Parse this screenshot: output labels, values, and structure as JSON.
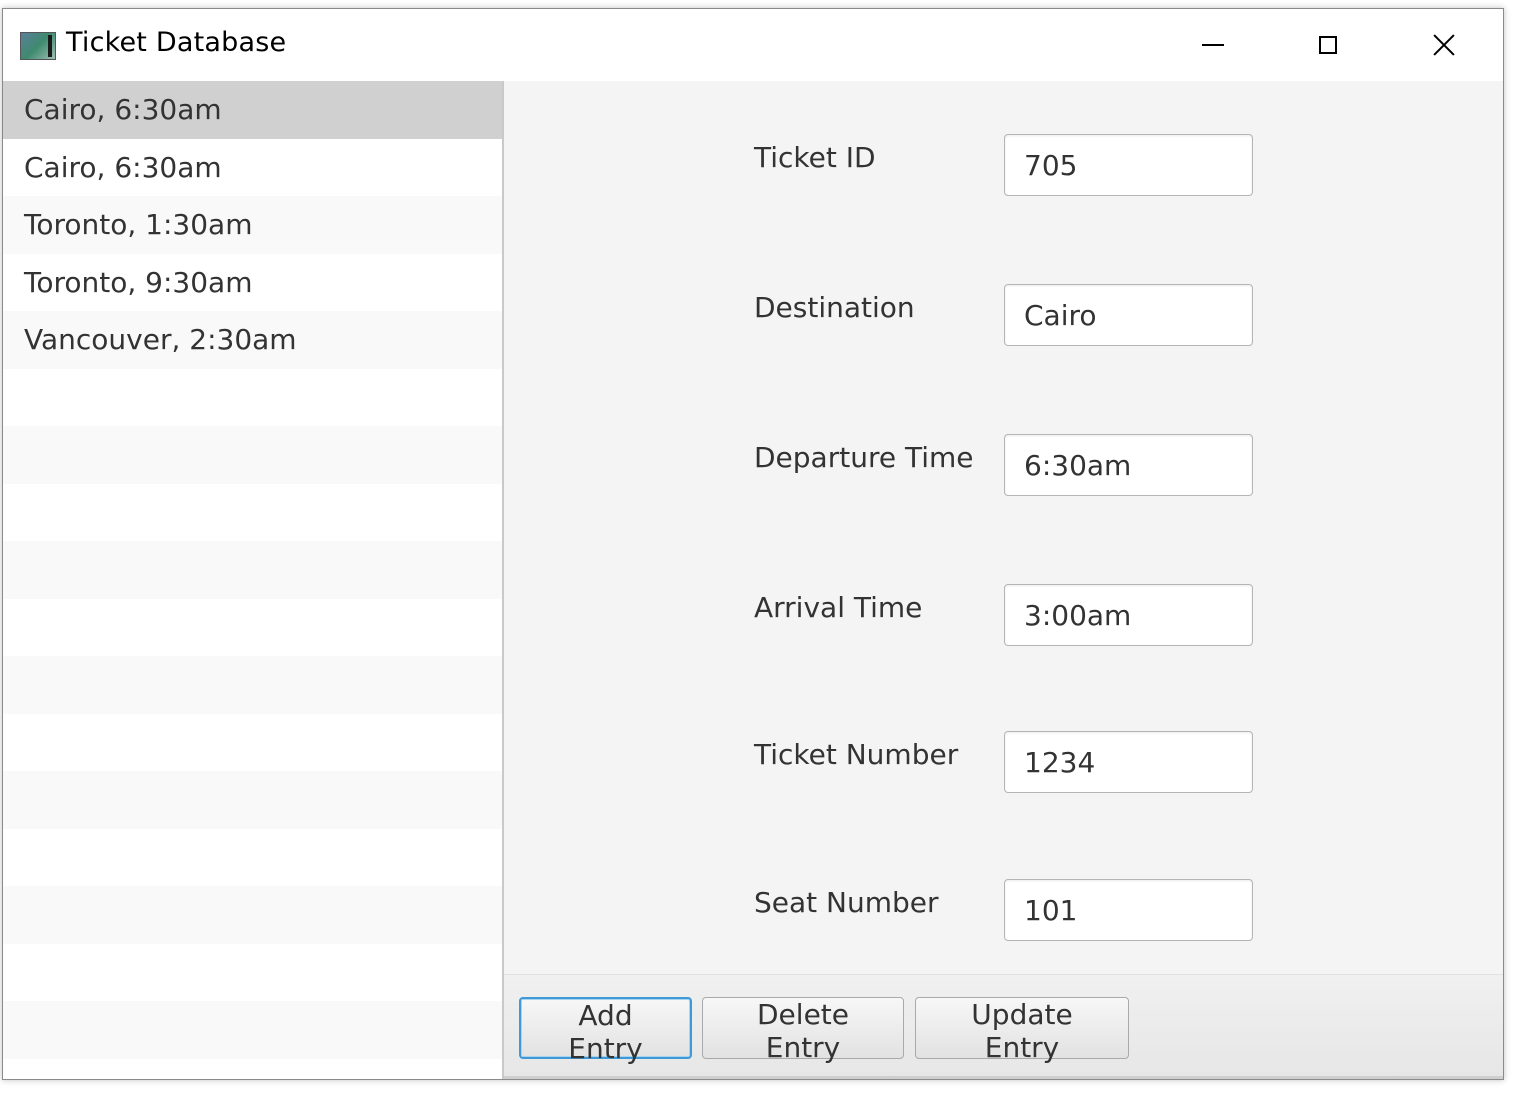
{
  "window": {
    "title": "Ticket Database"
  },
  "list": {
    "items": [
      {
        "label": "Cairo, 6:30am",
        "selected": true
      },
      {
        "label": "Cairo, 6:30am",
        "selected": false
      },
      {
        "label": "Toronto, 1:30am",
        "selected": false
      },
      {
        "label": "Toronto, 9:30am",
        "selected": false
      },
      {
        "label": "Vancouver, 2:30am",
        "selected": false
      }
    ]
  },
  "form": {
    "fields": [
      {
        "label": "Ticket ID",
        "value": "705"
      },
      {
        "label": "Destination",
        "value": "Cairo"
      },
      {
        "label": "Departure Time",
        "value": "6:30am"
      },
      {
        "label": "Arrival Time",
        "value": "3:00am"
      },
      {
        "label": "Ticket Number",
        "value": "1234"
      },
      {
        "label": "Seat Number",
        "value": "101"
      }
    ]
  },
  "buttons": {
    "add": "Add Entry",
    "delete": "Delete Entry",
    "update": "Update Entry"
  },
  "colors": {
    "selected_row": "#d0d0d0",
    "focus_ring": "#3d9ad6",
    "window_bg": "#f4f4f4"
  }
}
